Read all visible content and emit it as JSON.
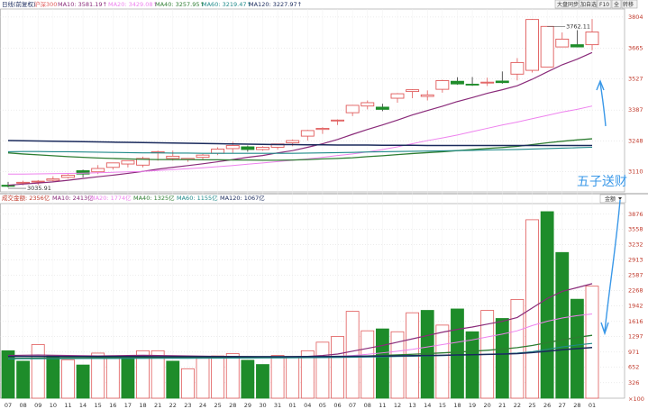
{
  "colors": {
    "up": "#e05a5a",
    "down": "#1e8c2a",
    "ma5": "#9a9a9a",
    "ma10": "#8a2b7a",
    "ma20": "#ee82ee",
    "ma40": "#2e7d32",
    "ma60": "#1f8a8a",
    "ma120": "#1a2a5c",
    "annotation": "#3a98e8",
    "grid": "#d9d9d9",
    "axis_text": "#c0392b"
  },
  "price_header": {
    "period": "日线(前复权)",
    "symbol": "沪深300",
    "ma10": "MA10: 3581.19↑",
    "ma20": "MA20: 3429.08↑",
    "ma40": "MA40: 3257.95↑",
    "ma60": "MA60: 3219.47↑",
    "ma120": "MA120: 3227.97↑"
  },
  "volume_header": {
    "title": "成交金额: 2356亿",
    "ma10": "MA10: 2413亿",
    "ma20": "MA20: 1774亿",
    "ma40": "MA40: 1325亿",
    "ma60": "MA60: 1155亿",
    "ma120": "MA120: 1067亿"
  },
  "top_buttons": [
    "大盘同步",
    "加自选",
    "F10",
    "全",
    "转移"
  ],
  "volume_dropdown": "金额",
  "annotation_text": "五子送财",
  "chart_data": [
    {
      "type": "candlestick",
      "x": [
        "07",
        "08",
        "09",
        "10",
        "11",
        "14",
        "15",
        "16",
        "17",
        "18",
        "21",
        "22",
        "23",
        "24",
        "25",
        "28",
        "29",
        "30",
        "31",
        "01",
        "04",
        "05",
        "06",
        "07",
        "08",
        "11",
        "12",
        "13",
        "14",
        "15",
        "18",
        "19",
        "20",
        "21",
        "22",
        "25",
        "26",
        "27",
        "28",
        "01"
      ],
      "tick_labels_shown": [
        "07",
        "08",
        "09",
        "10",
        "11",
        "14",
        "15",
        "16",
        "17",
        "18",
        "21",
        "22",
        "23",
        "24",
        "25",
        "28",
        "29",
        "30",
        "31",
        "01",
        "04",
        "05",
        "06",
        "07",
        "08",
        "11",
        "12",
        "13",
        "14",
        "15",
        "18",
        "19",
        "20",
        "21",
        "22",
        "25",
        "26",
        "27",
        "28",
        "01"
      ],
      "open": [
        3050,
        3060,
        3065,
        3072,
        3085,
        3115,
        3110,
        3130,
        3145,
        3140,
        3195,
        3170,
        3165,
        3175,
        3193,
        3214,
        3222,
        3210,
        3220,
        3240,
        3270,
        3300,
        3338,
        3375,
        3405,
        3400,
        3440,
        3470,
        3448,
        3480,
        3516,
        3503,
        3508,
        3517,
        3548,
        3565,
        3580,
        3670,
        3680,
        3680
      ],
      "high": [
        3065,
        3070,
        3073,
        3090,
        3100,
        3120,
        3140,
        3150,
        3160,
        3178,
        3205,
        3205,
        3170,
        3190,
        3220,
        3245,
        3228,
        3225,
        3230,
        3255,
        3298,
        3310,
        3345,
        3410,
        3430,
        3415,
        3463,
        3480,
        3475,
        3523,
        3534,
        3535,
        3532,
        3560,
        3620,
        3795,
        3762,
        3735,
        3745,
        3795
      ],
      "low": [
        3040,
        3050,
        3050,
        3065,
        3080,
        3085,
        3100,
        3120,
        3130,
        3130,
        3160,
        3160,
        3155,
        3165,
        3185,
        3195,
        3200,
        3205,
        3210,
        3225,
        3250,
        3280,
        3320,
        3360,
        3390,
        3382,
        3420,
        3440,
        3430,
        3465,
        3500,
        3495,
        3495,
        3505,
        3520,
        3555,
        3728,
        3700,
        3668,
        3655
      ],
      "close": [
        3045,
        3063,
        3068,
        3078,
        3095,
        3100,
        3125,
        3150,
        3160,
        3170,
        3200,
        3180,
        3170,
        3185,
        3212,
        3228,
        3210,
        3220,
        3235,
        3250,
        3295,
        3305,
        3342,
        3408,
        3420,
        3390,
        3460,
        3478,
        3455,
        3519,
        3504,
        3502,
        3512,
        3510,
        3600,
        3793,
        3762,
        3705,
        3670,
        3737
      ],
      "ma_lines": {
        "MA10": [
          3050,
          3055,
          3060,
          3065,
          3072,
          3080,
          3088,
          3095,
          3103,
          3112,
          3122,
          3130,
          3138,
          3146,
          3155,
          3165,
          3175,
          3183,
          3195,
          3205,
          3220,
          3236,
          3255,
          3278,
          3300,
          3320,
          3342,
          3365,
          3385,
          3404,
          3425,
          3443,
          3462,
          3478,
          3496,
          3525,
          3558,
          3590,
          3615,
          3645
        ],
        "MA20": [
          3100,
          3100,
          3101,
          3102,
          3103,
          3104,
          3106,
          3108,
          3110,
          3112,
          3116,
          3120,
          3124,
          3128,
          3133,
          3138,
          3144,
          3150,
          3156,
          3162,
          3168,
          3175,
          3183,
          3190,
          3199,
          3210,
          3222,
          3236,
          3250,
          3262,
          3275,
          3290,
          3305,
          3320,
          3333,
          3348,
          3363,
          3378,
          3390,
          3405
        ],
        "MA40": [
          3195,
          3190,
          3186,
          3182,
          3178,
          3175,
          3172,
          3170,
          3168,
          3166,
          3165,
          3165,
          3165,
          3164,
          3164,
          3163,
          3163,
          3162,
          3162,
          3163,
          3165,
          3168,
          3170,
          3173,
          3178,
          3182,
          3187,
          3192,
          3196,
          3200,
          3205,
          3210,
          3215,
          3219,
          3224,
          3232,
          3240,
          3247,
          3253,
          3258
        ],
        "MA60": [
          3200,
          3201,
          3201,
          3200,
          3200,
          3199,
          3198,
          3197,
          3196,
          3195,
          3195,
          3194,
          3194,
          3193,
          3193,
          3193,
          3193,
          3193,
          3193,
          3193,
          3194,
          3195,
          3196,
          3197,
          3199,
          3200,
          3201,
          3202,
          3203,
          3204,
          3205,
          3206,
          3208,
          3209,
          3210,
          3212,
          3214,
          3216,
          3218,
          3220
        ],
        "MA120": [
          3250,
          3249,
          3248,
          3247,
          3246,
          3245,
          3244,
          3243,
          3242,
          3241,
          3240,
          3239,
          3238,
          3237,
          3236,
          3235,
          3234,
          3233,
          3232,
          3232,
          3231,
          3231,
          3230,
          3230,
          3230,
          3229,
          3229,
          3229,
          3228,
          3228,
          3228,
          3228,
          3228,
          3228,
          3228,
          3228,
          3228,
          3228,
          3228,
          3228
        ]
      },
      "ylim": [
        3020,
        3840
      ],
      "y_ticks": [
        3110,
        3248,
        3387,
        3527,
        3665,
        3804
      ],
      "price_annotations": [
        {
          "index": 0,
          "value": 3035.91,
          "label": "3035.91"
        },
        {
          "index": 36,
          "value": 3762.11,
          "label": "3762.11"
        }
      ]
    },
    {
      "type": "bar",
      "x": [
        "07",
        "08",
        "09",
        "10",
        "11",
        "14",
        "15",
        "16",
        "17",
        "18",
        "21",
        "22",
        "23",
        "24",
        "25",
        "28",
        "29",
        "30",
        "31",
        "01",
        "04",
        "05",
        "06",
        "07",
        "08",
        "11",
        "12",
        "13",
        "14",
        "15",
        "18",
        "19",
        "20",
        "21",
        "22",
        "25",
        "26",
        "27",
        "28",
        "01"
      ],
      "values": [
        1000,
        780,
        1130,
        900,
        810,
        700,
        950,
        880,
        830,
        1000,
        1000,
        780,
        620,
        840,
        890,
        940,
        800,
        710,
        900,
        880,
        1000,
        1180,
        1300,
        1830,
        1420,
        1460,
        1400,
        1800,
        1850,
        1540,
        1880,
        1400,
        1850,
        1680,
        2080,
        3760,
        3930,
        3070,
        2085,
        2360
      ],
      "up": [
        false,
        false,
        true,
        false,
        true,
        false,
        true,
        true,
        false,
        true,
        true,
        false,
        true,
        true,
        true,
        true,
        false,
        false,
        true,
        true,
        true,
        true,
        true,
        true,
        true,
        false,
        true,
        true,
        false,
        true,
        false,
        false,
        true,
        false,
        true,
        true,
        false,
        false,
        false,
        true
      ],
      "ma_lines": {
        "MA10": [
          900,
          905,
          910,
          905,
          900,
          895,
          890,
          895,
          900,
          905,
          900,
          895,
          890,
          885,
          880,
          880,
          875,
          870,
          870,
          870,
          880,
          900,
          930,
          990,
          1050,
          1110,
          1180,
          1250,
          1320,
          1390,
          1450,
          1500,
          1560,
          1620,
          1700,
          1900,
          2100,
          2250,
          2330,
          2413
        ],
        "MA20": [
          880,
          882,
          884,
          885,
          885,
          884,
          883,
          882,
          880,
          878,
          876,
          874,
          872,
          870,
          868,
          866,
          864,
          862,
          862,
          862,
          865,
          870,
          880,
          900,
          925,
          955,
          990,
          1030,
          1080,
          1130,
          1180,
          1230,
          1290,
          1350,
          1420,
          1530,
          1620,
          1690,
          1740,
          1774
        ],
        "MA40": [
          840,
          842,
          844,
          846,
          848,
          850,
          852,
          853,
          854,
          855,
          856,
          856,
          856,
          856,
          856,
          857,
          857,
          858,
          858,
          860,
          862,
          866,
          872,
          880,
          890,
          900,
          912,
          925,
          940,
          955,
          972,
          990,
          1010,
          1035,
          1065,
          1110,
          1170,
          1230,
          1280,
          1325
        ],
        "MA60": [
          830,
          831,
          832,
          833,
          834,
          835,
          836,
          837,
          838,
          839,
          840,
          841,
          842,
          843,
          844,
          845,
          846,
          847,
          848,
          850,
          852,
          855,
          858,
          862,
          867,
          872,
          878,
          884,
          891,
          898,
          906,
          915,
          925,
          936,
          950,
          980,
          1030,
          1080,
          1120,
          1155
        ],
        "MA120": [
          880,
          880,
          880,
          879,
          879,
          878,
          878,
          878,
          877,
          877,
          876,
          876,
          876,
          875,
          875,
          875,
          875,
          875,
          875,
          876,
          877,
          878,
          880,
          882,
          885,
          888,
          892,
          896,
          900,
          905,
          910,
          916,
          922,
          930,
          940,
          960,
          990,
          1020,
          1045,
          1067
        ]
      },
      "ylim": [
        0,
        4100
      ],
      "y_ticks": [
        326,
        652,
        971,
        1297,
        1616,
        1942,
        2268,
        2587,
        2913,
        3232,
        3558,
        3876
      ]
    }
  ]
}
